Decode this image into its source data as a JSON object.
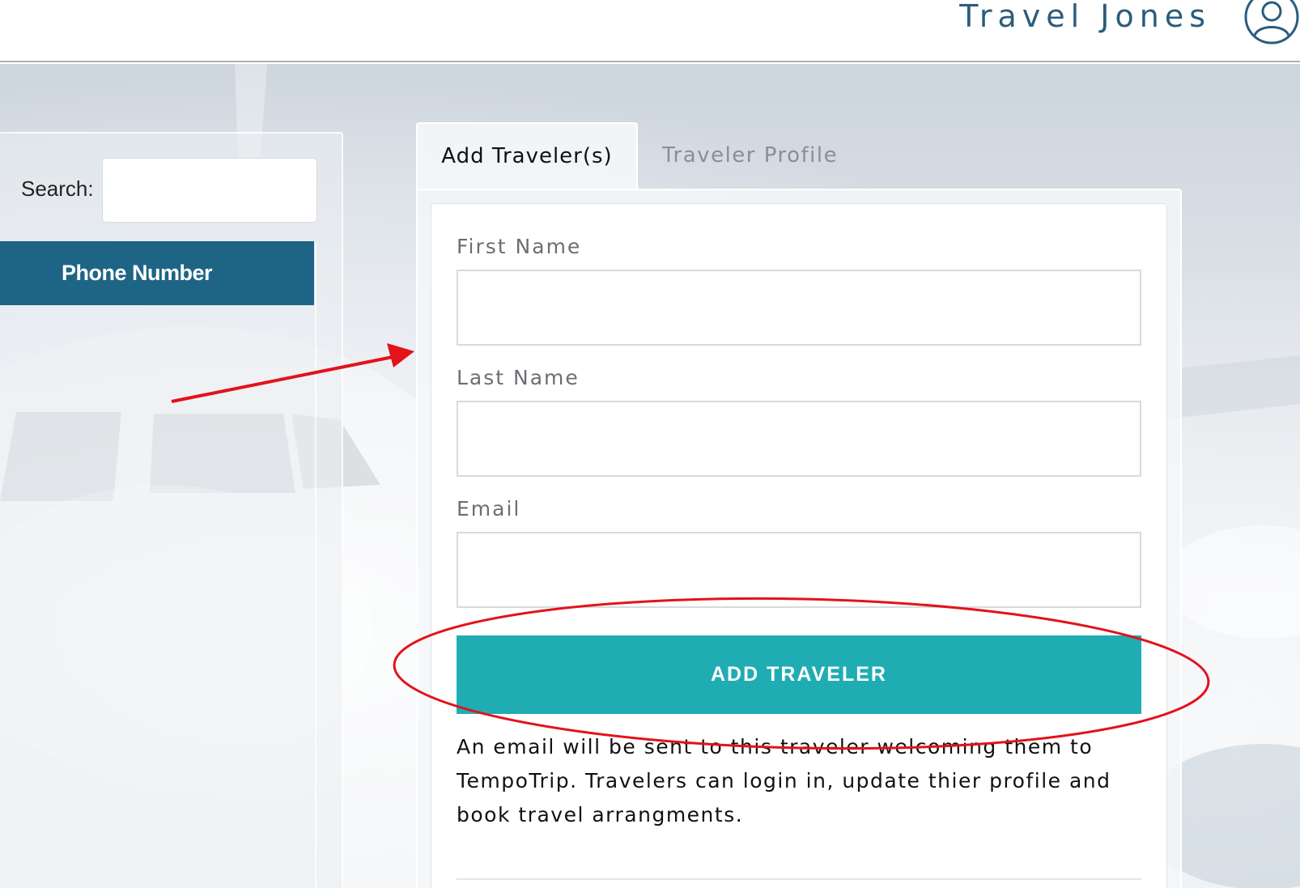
{
  "header": {
    "brand": "Travel Jones",
    "user_icon": "user-icon"
  },
  "sidebar": {
    "search_label": "Search:",
    "search_value": "",
    "table_header": "Phone Number"
  },
  "tabs": [
    {
      "label": "Add Traveler(s)",
      "active": true
    },
    {
      "label": "Traveler Profile",
      "active": false
    }
  ],
  "form": {
    "first_name_label": "First Name",
    "first_name_value": "",
    "last_name_label": "Last Name",
    "last_name_value": "",
    "email_label": "Email",
    "email_value": "",
    "submit_label": "ADD TRAVELER",
    "note": "An email will be sent to this traveler welcoming them to TempoTrip. Travelers can login in, update thier profile and book travel arrangments."
  },
  "colors": {
    "brand": "#2a5d7c",
    "table_header_bg": "#1e6485",
    "button_bg": "#1fadb3",
    "annotation": "#e3121b"
  }
}
